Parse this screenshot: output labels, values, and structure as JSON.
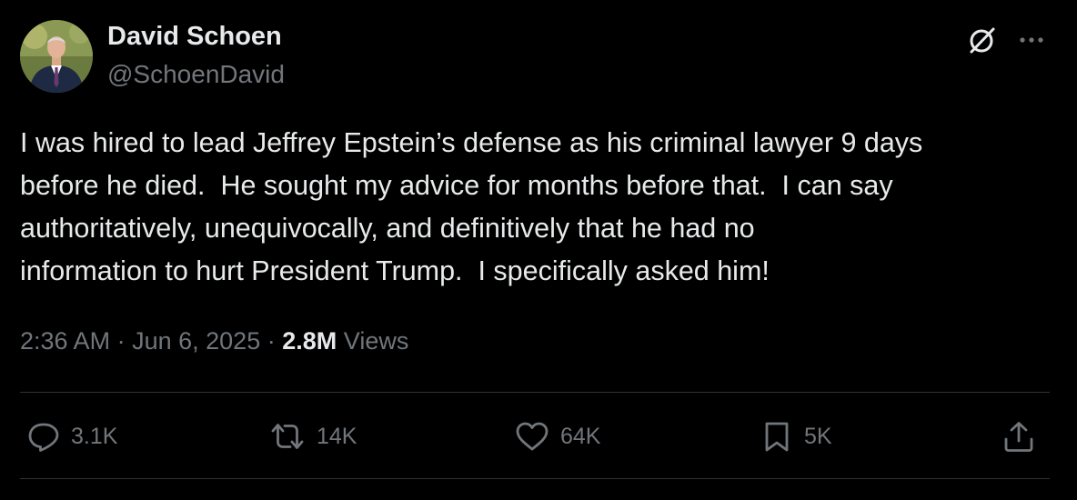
{
  "author": {
    "display_name": "David Schoen",
    "handle": "@SchoenDavid"
  },
  "header_icons": {
    "grok": "grok-icon",
    "more": "more-icon"
  },
  "tweet": {
    "text": "I was hired to lead Jeffrey Epstein’s defense as his criminal lawyer 9 days\nbefore he died.  He sought my advice for months before that.  I can say\nauthoritatively, unequivocally, and definitively that he had no\ninformation to hurt President Trump.  I specifically asked him!"
  },
  "meta": {
    "time": "2:36 AM",
    "separator": "·",
    "date": "Jun 6, 2025",
    "views_count": "2.8M",
    "views_label": "Views"
  },
  "actions": {
    "reply": {
      "icon": "reply-icon",
      "count": "3.1K"
    },
    "retweet": {
      "icon": "retweet-icon",
      "count": "14K"
    },
    "like": {
      "icon": "heart-icon",
      "count": "64K"
    },
    "bookmark": {
      "icon": "bookmark-icon",
      "count": "5K"
    },
    "share": {
      "icon": "share-icon"
    }
  },
  "colors": {
    "background": "#000000",
    "primary_text": "#e7e9ea",
    "secondary_text": "#71767b",
    "divider": "#2f3336"
  }
}
